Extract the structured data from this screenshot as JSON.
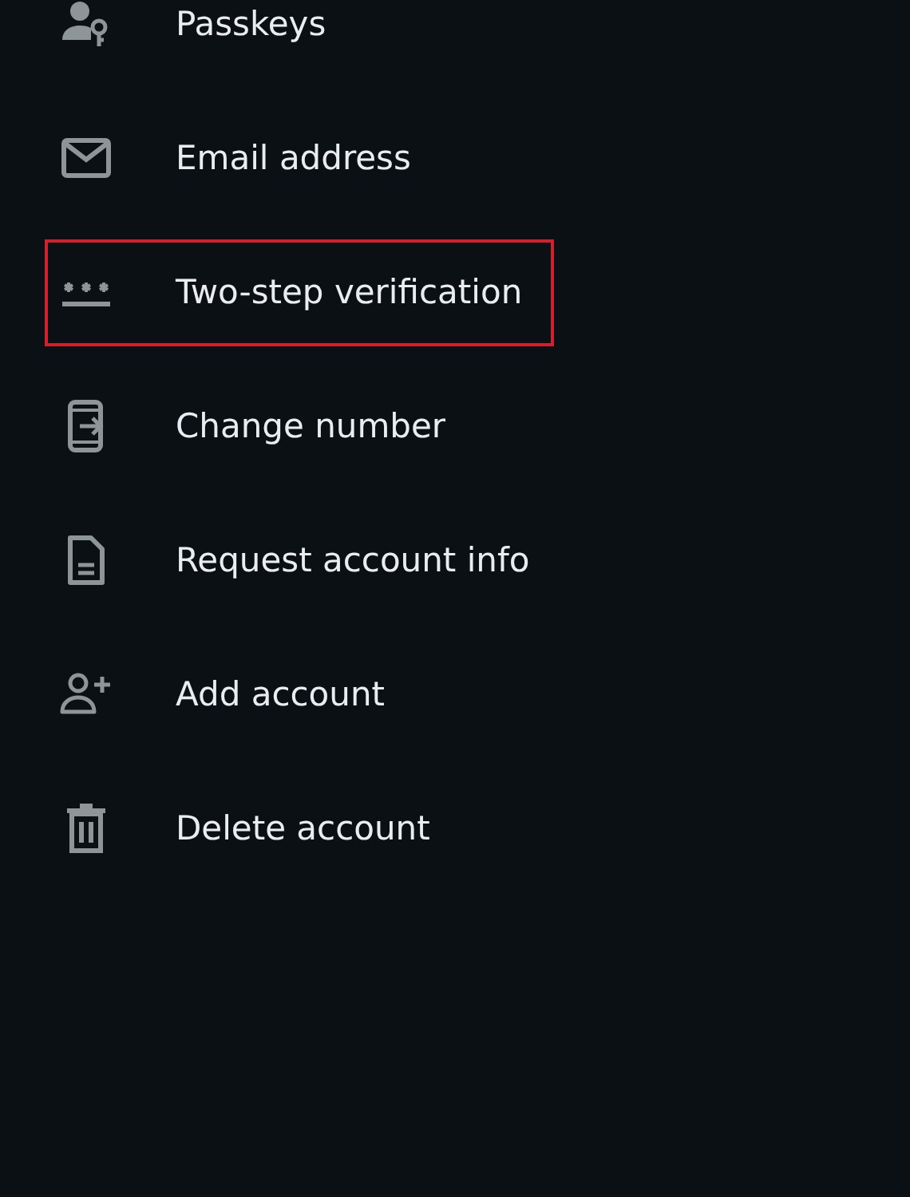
{
  "items": [
    {
      "kind": "passkey",
      "label": "Passkeys",
      "highlighted": false
    },
    {
      "kind": "email",
      "label": "Email address",
      "highlighted": false
    },
    {
      "kind": "password",
      "label": "Two-step verification",
      "highlighted": true
    },
    {
      "kind": "phone",
      "label": "Change number",
      "highlighted": false
    },
    {
      "kind": "document",
      "label": "Request account info",
      "highlighted": false
    },
    {
      "kind": "add-person",
      "label": "Add account",
      "highlighted": false
    },
    {
      "kind": "trash",
      "label": "Delete account",
      "highlighted": false
    }
  ]
}
